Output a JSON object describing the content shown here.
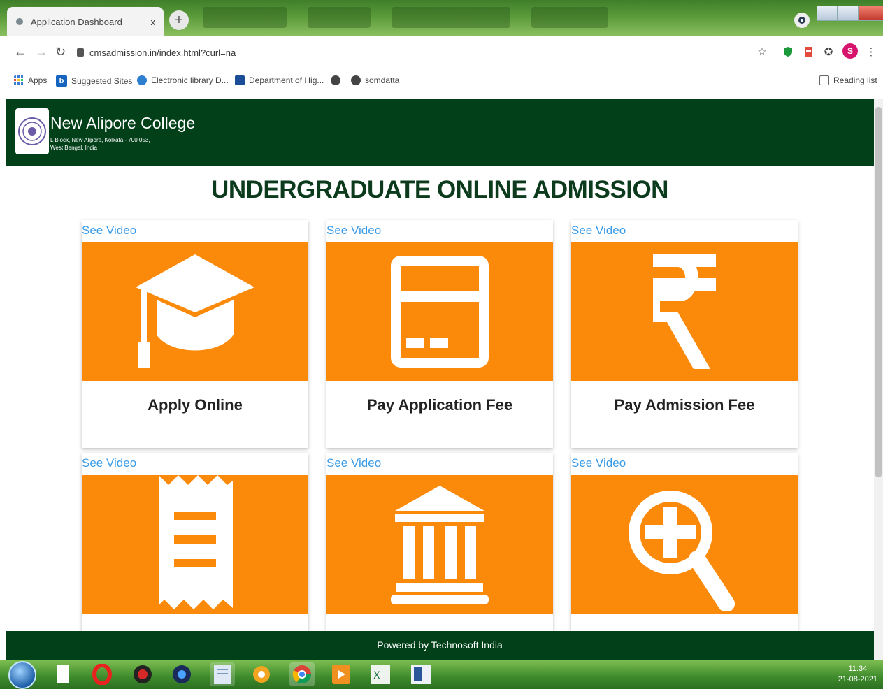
{
  "browser": {
    "tab_title": "Application Dashboard",
    "tab_close": "x",
    "new_tab": "+",
    "url": "cmsadmission.in/index.html?curl=na",
    "profile_initial": "S",
    "bookmarks": {
      "apps": "Apps",
      "suggested": "Suggested Sites",
      "library": "Electronic library D...",
      "department": "Department of Hig...",
      "somdatta": "somdatta",
      "reading_list": "Reading list"
    }
  },
  "header": {
    "college_name": "New Alipore College",
    "address_line1": "L Block, New Alipore, Kolkata - 700 053,",
    "address_line2": "West Bengal, India"
  },
  "page": {
    "title": "UNDERGRADUATE ONLINE ADMISSION"
  },
  "cards": {
    "c1": {
      "video": "See Video",
      "label": "Apply Online"
    },
    "c2": {
      "video": "See Video",
      "label": "Pay Application Fee"
    },
    "c3": {
      "video": "See Video",
      "label": "Pay Admission Fee"
    },
    "c4": {
      "video": "See Video"
    },
    "c5": {
      "video": "See Video"
    },
    "c6": {
      "video": "See Video"
    }
  },
  "footer": {
    "text": "Powered by Technosoft India"
  },
  "taskbar": {
    "time": "11:34",
    "date": "21-08-2021"
  },
  "colors": {
    "header_bg": "#024019",
    "card_orange": "#fb8a0a",
    "title_green": "#0b3b1c",
    "link_blue": "#3a9be8"
  },
  "icons": [
    "graduation-cap-icon",
    "credit-card-icon",
    "rupee-icon",
    "receipt-icon",
    "bank-icon",
    "zoom-in-icon"
  ]
}
